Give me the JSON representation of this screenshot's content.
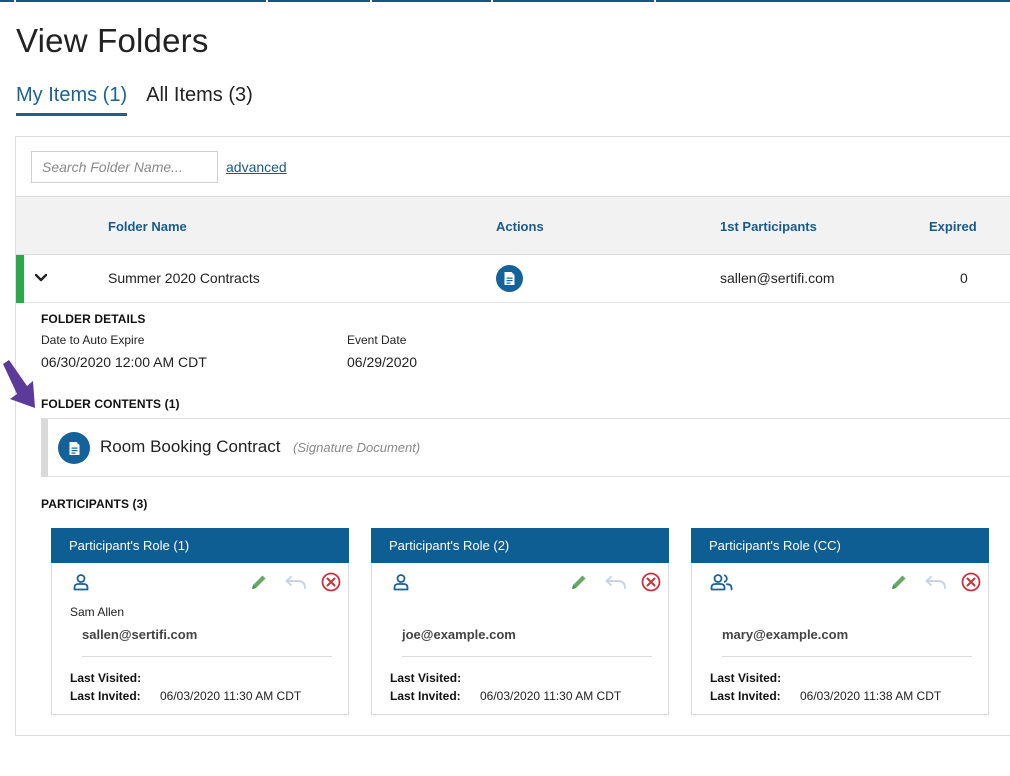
{
  "page": {
    "title": "View Folders"
  },
  "tabs": [
    {
      "label": "My Items (1)",
      "active": true
    },
    {
      "label": "All Items (3)",
      "active": false
    }
  ],
  "search": {
    "placeholder": "Search Folder Name...",
    "value": "",
    "advanced_label": "advanced"
  },
  "table": {
    "columns": [
      "Folder Name",
      "Actions",
      "1st Participants",
      "Expired"
    ],
    "rows": [
      {
        "folder_name": "Summer 2020 Contracts",
        "first_participant": "sallen@sertifi.com",
        "expired": "0",
        "status_color": "#2ba84a",
        "action_icon": "document-icon"
      }
    ]
  },
  "folder_details": {
    "title": "FOLDER DETAILS",
    "auto_expire_label": "Date to Auto Expire",
    "auto_expire_value": "06/30/2020 12:00 AM CDT",
    "event_date_label": "Event Date",
    "event_date_value": "06/29/2020"
  },
  "folder_contents": {
    "title": "FOLDER CONTENTS (1)",
    "items": [
      {
        "name": "Room Booking Contract",
        "type": "(Signature Document)"
      }
    ]
  },
  "participants": {
    "title": "PARTICIPANTS (3)",
    "cards": [
      {
        "role": "Participant's Role (1)",
        "icon": "user-icon",
        "name": "Sam Allen",
        "email": "sallen@sertifi.com",
        "last_visited_label": "Last Visited:",
        "last_visited": "",
        "last_invited_label": "Last Invited:",
        "last_invited": "06/03/2020 11:30 AM CDT"
      },
      {
        "role": "Participant's Role (2)",
        "icon": "user-icon",
        "name": "",
        "email": "joe@example.com",
        "last_visited_label": "Last Visited:",
        "last_visited": "",
        "last_invited_label": "Last Invited:",
        "last_invited": "06/03/2020 11:30 AM CDT"
      },
      {
        "role": "Participant's Role (CC)",
        "icon": "users-icon",
        "name": "",
        "email": "mary@example.com",
        "last_visited_label": "Last Visited:",
        "last_visited": "",
        "last_invited_label": "Last Invited:",
        "last_invited": "06/03/2020 11:38 AM CDT"
      }
    ]
  },
  "colors": {
    "accent": "#1a6296",
    "header_blue": "#0e5e94",
    "status_green": "#2ba84a",
    "edit_green": "#6aa86a",
    "remove_red": "#c8323c",
    "annotation_arrow": "#5b3a99"
  }
}
